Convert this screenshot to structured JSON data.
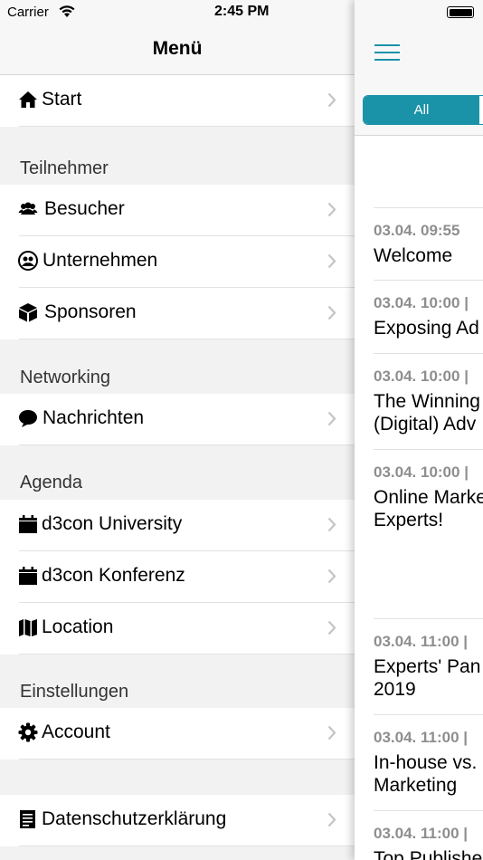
{
  "status_bar": {
    "carrier": "Carrier",
    "time": "2:45 PM"
  },
  "menu": {
    "title": "Menü",
    "start": "Start",
    "sections": {
      "teilnehmer": "Teilnehmer",
      "networking": "Networking",
      "agenda": "Agenda",
      "einstellungen": "Einstellungen"
    },
    "items": {
      "besucher": "Besucher",
      "unternehmen": "Unternehmen",
      "sponsoren": "Sponsoren",
      "nachrichten": "Nachrichten",
      "university": "d3con University",
      "konferenz": "d3con Konferenz",
      "location": "Location",
      "account": "Account",
      "datenschutz": "Datenschutzerklärung"
    }
  },
  "content": {
    "filter_all": "All",
    "accent_color": "#1a93a8",
    "events": [
      {
        "time": "03.04. 09:55",
        "title": "Welcome"
      },
      {
        "time": "03.04. 10:00 |",
        "title": "Exposing Ad"
      },
      {
        "time": "03.04. 10:00 |",
        "title": "The Winning\n(Digital) Adv"
      },
      {
        "time": "03.04. 10:00 |",
        "title": "Online Marke\nExperts!"
      },
      {
        "time": "03.04. 11:00 |",
        "title": "Experts' Pan\n2019"
      },
      {
        "time": "03.04. 11:00 |",
        "title": "In-house vs.\nMarketing"
      },
      {
        "time": "03.04. 11:00 |",
        "title": "Top Publishe"
      }
    ]
  }
}
